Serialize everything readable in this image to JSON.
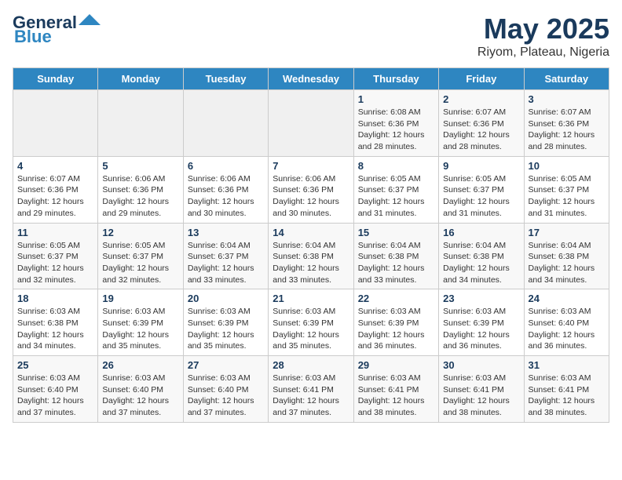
{
  "header": {
    "logo_line1": "General",
    "logo_line2": "Blue",
    "title": "May 2025",
    "subtitle": "Riyom, Plateau, Nigeria"
  },
  "calendar": {
    "days_of_week": [
      "Sunday",
      "Monday",
      "Tuesday",
      "Wednesday",
      "Thursday",
      "Friday",
      "Saturday"
    ],
    "weeks": [
      [
        {
          "day": "",
          "content": ""
        },
        {
          "day": "",
          "content": ""
        },
        {
          "day": "",
          "content": ""
        },
        {
          "day": "",
          "content": ""
        },
        {
          "day": "1",
          "content": "Sunrise: 6:08 AM\nSunset: 6:36 PM\nDaylight: 12 hours\nand 28 minutes."
        },
        {
          "day": "2",
          "content": "Sunrise: 6:07 AM\nSunset: 6:36 PM\nDaylight: 12 hours\nand 28 minutes."
        },
        {
          "day": "3",
          "content": "Sunrise: 6:07 AM\nSunset: 6:36 PM\nDaylight: 12 hours\nand 28 minutes."
        }
      ],
      [
        {
          "day": "4",
          "content": "Sunrise: 6:07 AM\nSunset: 6:36 PM\nDaylight: 12 hours\nand 29 minutes."
        },
        {
          "day": "5",
          "content": "Sunrise: 6:06 AM\nSunset: 6:36 PM\nDaylight: 12 hours\nand 29 minutes."
        },
        {
          "day": "6",
          "content": "Sunrise: 6:06 AM\nSunset: 6:36 PM\nDaylight: 12 hours\nand 30 minutes."
        },
        {
          "day": "7",
          "content": "Sunrise: 6:06 AM\nSunset: 6:36 PM\nDaylight: 12 hours\nand 30 minutes."
        },
        {
          "day": "8",
          "content": "Sunrise: 6:05 AM\nSunset: 6:37 PM\nDaylight: 12 hours\nand 31 minutes."
        },
        {
          "day": "9",
          "content": "Sunrise: 6:05 AM\nSunset: 6:37 PM\nDaylight: 12 hours\nand 31 minutes."
        },
        {
          "day": "10",
          "content": "Sunrise: 6:05 AM\nSunset: 6:37 PM\nDaylight: 12 hours\nand 31 minutes."
        }
      ],
      [
        {
          "day": "11",
          "content": "Sunrise: 6:05 AM\nSunset: 6:37 PM\nDaylight: 12 hours\nand 32 minutes."
        },
        {
          "day": "12",
          "content": "Sunrise: 6:05 AM\nSunset: 6:37 PM\nDaylight: 12 hours\nand 32 minutes."
        },
        {
          "day": "13",
          "content": "Sunrise: 6:04 AM\nSunset: 6:37 PM\nDaylight: 12 hours\nand 33 minutes."
        },
        {
          "day": "14",
          "content": "Sunrise: 6:04 AM\nSunset: 6:38 PM\nDaylight: 12 hours\nand 33 minutes."
        },
        {
          "day": "15",
          "content": "Sunrise: 6:04 AM\nSunset: 6:38 PM\nDaylight: 12 hours\nand 33 minutes."
        },
        {
          "day": "16",
          "content": "Sunrise: 6:04 AM\nSunset: 6:38 PM\nDaylight: 12 hours\nand 34 minutes."
        },
        {
          "day": "17",
          "content": "Sunrise: 6:04 AM\nSunset: 6:38 PM\nDaylight: 12 hours\nand 34 minutes."
        }
      ],
      [
        {
          "day": "18",
          "content": "Sunrise: 6:03 AM\nSunset: 6:38 PM\nDaylight: 12 hours\nand 34 minutes."
        },
        {
          "day": "19",
          "content": "Sunrise: 6:03 AM\nSunset: 6:39 PM\nDaylight: 12 hours\nand 35 minutes."
        },
        {
          "day": "20",
          "content": "Sunrise: 6:03 AM\nSunset: 6:39 PM\nDaylight: 12 hours\nand 35 minutes."
        },
        {
          "day": "21",
          "content": "Sunrise: 6:03 AM\nSunset: 6:39 PM\nDaylight: 12 hours\nand 35 minutes."
        },
        {
          "day": "22",
          "content": "Sunrise: 6:03 AM\nSunset: 6:39 PM\nDaylight: 12 hours\nand 36 minutes."
        },
        {
          "day": "23",
          "content": "Sunrise: 6:03 AM\nSunset: 6:39 PM\nDaylight: 12 hours\nand 36 minutes."
        },
        {
          "day": "24",
          "content": "Sunrise: 6:03 AM\nSunset: 6:40 PM\nDaylight: 12 hours\nand 36 minutes."
        }
      ],
      [
        {
          "day": "25",
          "content": "Sunrise: 6:03 AM\nSunset: 6:40 PM\nDaylight: 12 hours\nand 37 minutes."
        },
        {
          "day": "26",
          "content": "Sunrise: 6:03 AM\nSunset: 6:40 PM\nDaylight: 12 hours\nand 37 minutes."
        },
        {
          "day": "27",
          "content": "Sunrise: 6:03 AM\nSunset: 6:40 PM\nDaylight: 12 hours\nand 37 minutes."
        },
        {
          "day": "28",
          "content": "Sunrise: 6:03 AM\nSunset: 6:41 PM\nDaylight: 12 hours\nand 37 minutes."
        },
        {
          "day": "29",
          "content": "Sunrise: 6:03 AM\nSunset: 6:41 PM\nDaylight: 12 hours\nand 38 minutes."
        },
        {
          "day": "30",
          "content": "Sunrise: 6:03 AM\nSunset: 6:41 PM\nDaylight: 12 hours\nand 38 minutes."
        },
        {
          "day": "31",
          "content": "Sunrise: 6:03 AM\nSunset: 6:41 PM\nDaylight: 12 hours\nand 38 minutes."
        }
      ]
    ]
  }
}
